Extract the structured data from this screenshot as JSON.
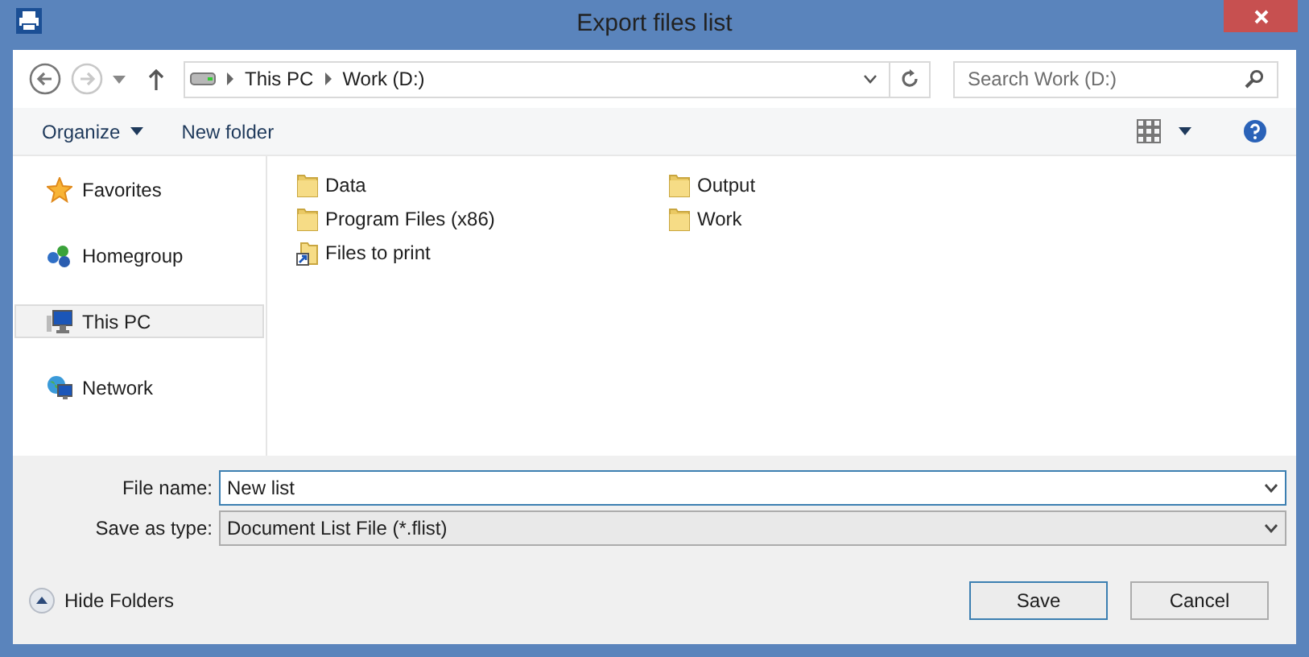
{
  "window": {
    "title": "Export files list"
  },
  "nav": [
    {
      "kind": "back",
      "disabled": false
    },
    {
      "kind": "forward",
      "disabled": true
    }
  ],
  "breadcrumb": [
    "This PC",
    "Work (D:)"
  ],
  "search": {
    "placeholder": "Search Work (D:)"
  },
  "toolbar": {
    "organize": "Organize",
    "new_folder": "New folder"
  },
  "sidebar": [
    {
      "label": "Favorites",
      "kind": "star",
      "selected": false
    },
    {
      "label": "Homegroup",
      "kind": "homegroup",
      "selected": false
    },
    {
      "label": "This PC",
      "kind": "pc",
      "selected": true
    },
    {
      "label": "Network",
      "kind": "network",
      "selected": false
    }
  ],
  "files": [
    {
      "name": "Data",
      "kind": "folder"
    },
    {
      "name": "Program Files (x86)",
      "kind": "folder"
    },
    {
      "name": "Files to print",
      "kind": "shortcut"
    },
    {
      "name": "Output",
      "kind": "folder"
    },
    {
      "name": "Work",
      "kind": "folder"
    }
  ],
  "form": [
    {
      "label": "File name:",
      "value": "New list",
      "editable": true
    },
    {
      "label": "Save as type:",
      "value": "Document List File (*.flist)",
      "editable": false
    }
  ],
  "hide_folders": "Hide Folders",
  "buttons": [
    {
      "label": "Save",
      "default": true
    },
    {
      "label": "Cancel",
      "default": false
    }
  ]
}
